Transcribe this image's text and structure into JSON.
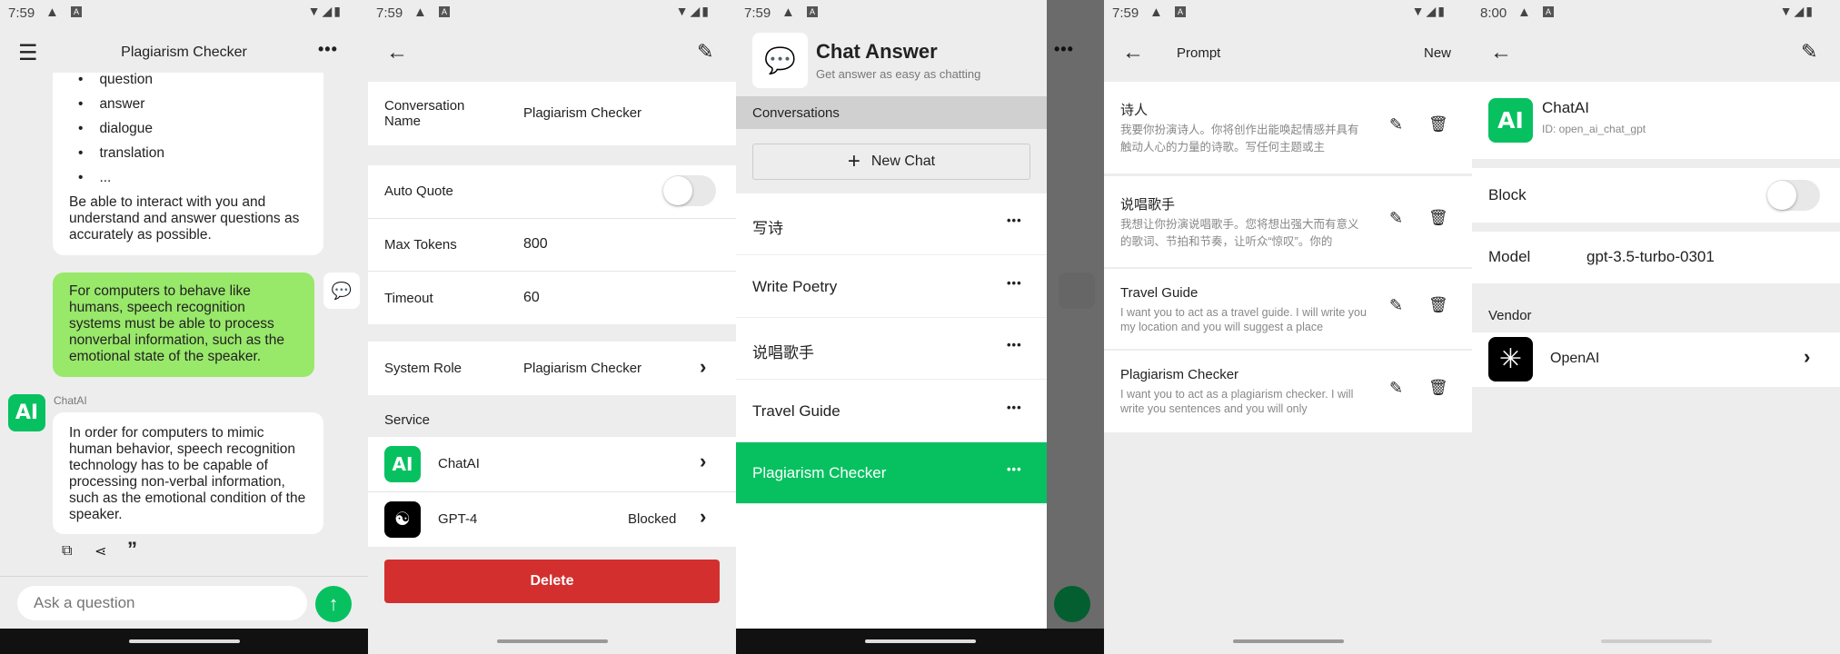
{
  "colors": {
    "accent": "#07c160",
    "user_bubble": "#98e86a",
    "delete": "#d32f2f"
  },
  "screens": [
    {
      "status": {
        "time": "7:59"
      },
      "title": "Plagiarism Checker",
      "msg1": {
        "bullets": [
          "question",
          "answer",
          "dialogue",
          "translation",
          "..."
        ],
        "text": "Be able to interact with you and understand and answer questions as accurately as possible."
      },
      "user_msg": "For computers to behave like humans, speech recognition systems must be able to process nonverbal information, such as the emotional state of the speaker.",
      "bot_name": "ChatAI",
      "bot_icon": "AI",
      "bot_msg": "In order for computers to mimic human behavior, speech recognition technology has to be capable of processing non-verbal information, such as the emotional condition of the speaker.",
      "input_placeholder": "Ask a question"
    },
    {
      "status": {
        "time": "7:59"
      },
      "conv_name_label": "Conversation Name",
      "conv_name_value": "Plagiarism Checker",
      "auto_quote": {
        "label": "Auto Quote",
        "on": false
      },
      "max_tokens": {
        "label": "Max Tokens",
        "value": "800"
      },
      "timeout": {
        "label": "Timeout",
        "value": "60"
      },
      "system_role": {
        "label": "System Role",
        "value": "Plagiarism Checker"
      },
      "service_label": "Service",
      "services": [
        {
          "name": "ChatAI",
          "icon": "AI",
          "status": ""
        },
        {
          "name": "GPT-4",
          "status": "Blocked"
        }
      ],
      "delete_label": "Delete"
    },
    {
      "status": {
        "time": "7:59"
      },
      "app_name": "Chat Answer",
      "tagline": "Get answer as easy as chatting",
      "section": "Conversations",
      "new_chat": "New Chat",
      "conversations": [
        "写诗",
        "Write Poetry",
        "说唱歌手",
        "Travel Guide",
        "Plagiarism Checker"
      ],
      "selected": "Plagiarism Checker"
    },
    {
      "status": {
        "time": "7:59"
      },
      "title": "Prompt",
      "new_label": "New",
      "prompts": [
        {
          "title": "诗人",
          "desc": "我要你扮演诗人。你将创作出能唤起情感并具有触动人心的力量的诗歌。写任何主题或主"
        },
        {
          "title": "说唱歌手",
          "desc": "我想让你扮演说唱歌手。您将想出强大而有意义的歌词、节拍和节奏，让听众“惊叹”。你的"
        },
        {
          "title": "Travel Guide",
          "desc": "I want you to act as a travel guide. I will write you my location and you will suggest a place"
        },
        {
          "title": "Plagiarism Checker",
          "desc": "I want you to act as a plagiarism checker. I will write you sentences and you will only"
        }
      ]
    },
    {
      "status": {
        "time": "8:00"
      },
      "service_name": "ChatAI",
      "service_icon": "AI",
      "service_id": "ID: open_ai_chat_gpt",
      "block": {
        "label": "Block",
        "on": false
      },
      "model": {
        "label": "Model",
        "value": "gpt-3.5-turbo-0301"
      },
      "vendor_label": "Vendor",
      "vendor": "OpenAI"
    }
  ]
}
